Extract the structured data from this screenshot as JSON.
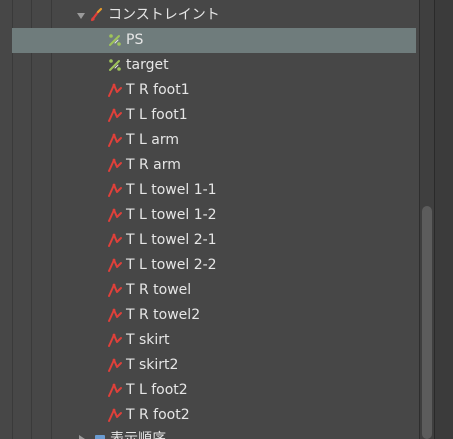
{
  "tree": {
    "group_label": "コンストレイント",
    "group_icon": "constraint-folder-icon",
    "items": [
      {
        "label": "PS",
        "icon": "bone-ik-icon",
        "selected": true
      },
      {
        "label": "target",
        "icon": "bone-ik-icon"
      },
      {
        "label": "T R foot1",
        "icon": "physics-constraint-icon"
      },
      {
        "label": "T L foot1",
        "icon": "physics-constraint-icon"
      },
      {
        "label": "T L arm",
        "icon": "physics-constraint-icon"
      },
      {
        "label": "T R arm",
        "icon": "physics-constraint-icon"
      },
      {
        "label": "T L towel 1-1",
        "icon": "physics-constraint-icon"
      },
      {
        "label": "T L towel 1-2",
        "icon": "physics-constraint-icon"
      },
      {
        "label": "T L towel 2-1",
        "icon": "physics-constraint-icon"
      },
      {
        "label": "T L towel 2-2",
        "icon": "physics-constraint-icon"
      },
      {
        "label": "T R towel",
        "icon": "physics-constraint-icon"
      },
      {
        "label": "T R towel2",
        "icon": "physics-constraint-icon"
      },
      {
        "label": "T skirt",
        "icon": "physics-constraint-icon"
      },
      {
        "label": "T skirt2",
        "icon": "physics-constraint-icon"
      },
      {
        "label": "T L foot2",
        "icon": "physics-constraint-icon"
      },
      {
        "label": "T R foot2",
        "icon": "physics-constraint-icon"
      }
    ],
    "next_group_label": "表示順序"
  },
  "colors": {
    "background": "#474747",
    "selected_row": "#6f7c7c",
    "text": "#e6e6e6",
    "constraint_red": "#e0403a",
    "ik_green": "#9fc45a"
  }
}
